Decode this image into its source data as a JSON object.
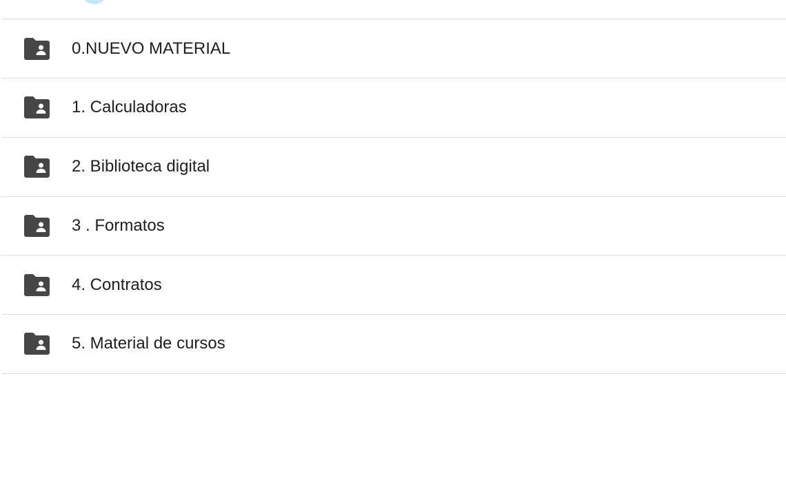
{
  "folders": [
    {
      "name": "0.NUEVO MATERIAL",
      "icon": "shared-folder-icon"
    },
    {
      "name": "1. Calculadoras",
      "icon": "shared-folder-icon"
    },
    {
      "name": "2. Biblioteca digital",
      "icon": "shared-folder-icon"
    },
    {
      "name": "3 . Formatos",
      "icon": "shared-folder-icon"
    },
    {
      "name": "4. Contratos",
      "icon": "shared-folder-icon"
    },
    {
      "name": "5. Material de cursos",
      "icon": "shared-folder-icon"
    }
  ],
  "colors": {
    "icon": "#444746",
    "text": "#1f1f1f",
    "divider": "#dadce0",
    "avatar": "#c2e7ff"
  }
}
